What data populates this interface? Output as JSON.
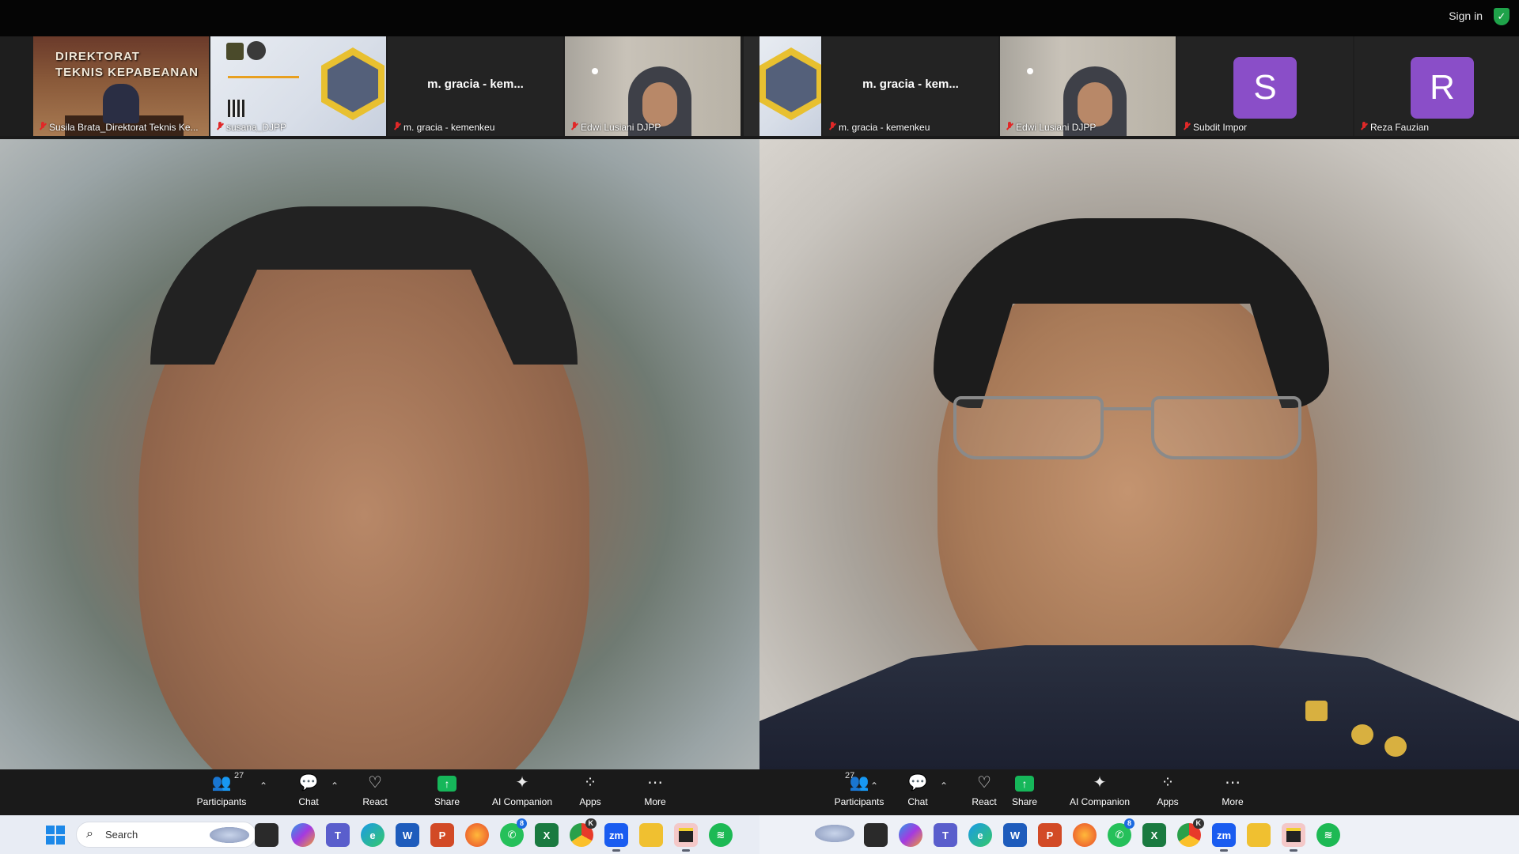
{
  "topbar": {
    "signin": "Sign in",
    "shield_icon": "shield-check-icon"
  },
  "left_panel": {
    "thumbs": [
      {
        "name": "Susila Brata_Direktorat Teknis Ke...",
        "sign_text_1": "DIREKTORAT",
        "sign_text_2": "TEKNIS KEPABEANAN"
      },
      {
        "name": "susana_DJPP"
      },
      {
        "name": "m. gracia - kemenkeu",
        "center_label": "m. gracia - kem..."
      },
      {
        "name": "Edwi Lusiani DJPP"
      }
    ],
    "toolbar": {
      "participants_label": "Participants",
      "participants_count": "27",
      "chat_label": "Chat",
      "react_label": "React",
      "share_label": "Share",
      "ai_label": "AI Companion",
      "apps_label": "Apps",
      "more_label": "More"
    }
  },
  "right_panel": {
    "thumbs": [
      {
        "name": "m. gracia - kemenkeu",
        "center_label": "m. gracia - kem..."
      },
      {
        "name": "Edwi Lusiani DJPP"
      },
      {
        "name": "Subdit Impor",
        "avatar_letter": "S"
      },
      {
        "name": "Reza Fauzian",
        "avatar_letter": "R"
      }
    ],
    "toolbar": {
      "participants_label": "Participants",
      "participants_count": "27",
      "chat_label": "Chat",
      "react_label": "React",
      "share_label": "Share",
      "ai_label": "AI Companion",
      "apps_label": "Apps",
      "more_label": "More"
    }
  },
  "taskbar": {
    "search_placeholder": "Search",
    "whatsapp_badge": "8",
    "chrome_badge": "K",
    "zoom_label": "zm",
    "word_label": "W",
    "excel_label": "X",
    "ppt_label": "P"
  },
  "colors": {
    "share_green": "#16b75a",
    "avatar_purple": "#8a4ec8",
    "mic_red": "#e02828"
  }
}
